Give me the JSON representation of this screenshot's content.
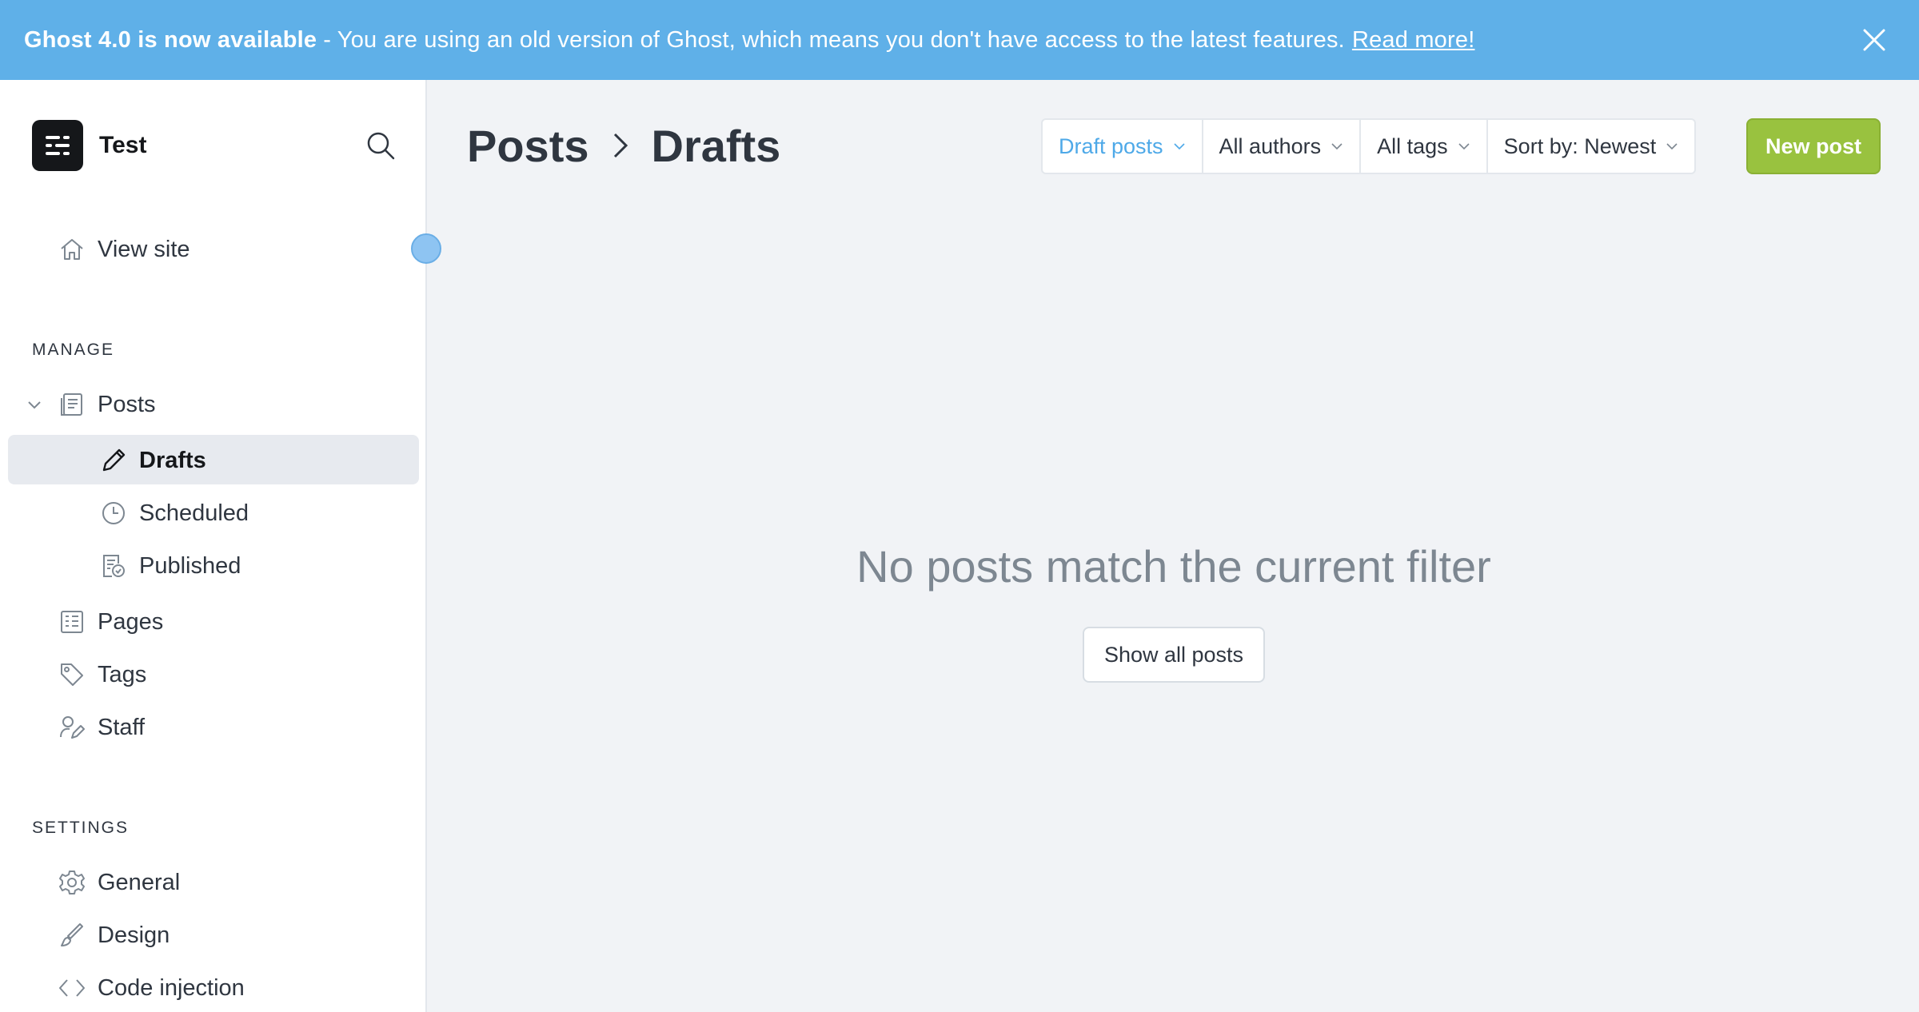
{
  "banner": {
    "strong": "Ghost 4.0 is now available",
    "text": "- You are using an old version of Ghost, which means you don't have access to the latest features.",
    "link": "Read more!",
    "close_icon": "close-icon"
  },
  "sidebar": {
    "site_name": "Test",
    "view_site": "View site",
    "manage_title": "MANAGE",
    "settings_title": "SETTINGS",
    "items": {
      "posts": "Posts",
      "drafts": "Drafts",
      "scheduled": "Scheduled",
      "published": "Published",
      "pages": "Pages",
      "tags": "Tags",
      "staff": "Staff",
      "general": "General",
      "design": "Design",
      "code_injection": "Code injection"
    }
  },
  "header": {
    "crumb_root": "Posts",
    "crumb_current": "Drafts"
  },
  "filters": {
    "type": "Draft posts",
    "authors": "All authors",
    "tags": "All tags",
    "sort": "Sort by: Newest"
  },
  "new_post_label": "New post",
  "empty_state": {
    "title": "No posts match the current filter",
    "button": "Show all posts"
  },
  "colors": {
    "banner": "#5fb0e8",
    "accent_blue": "#4ea9e8",
    "new_post_green": "#99c23f",
    "active_bg": "#e7eaef"
  }
}
